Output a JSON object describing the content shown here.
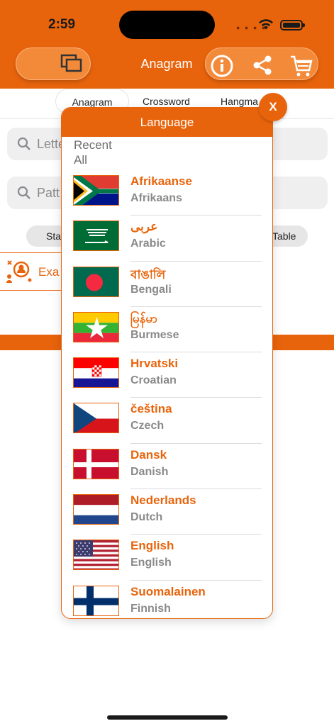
{
  "status_bar": {
    "time": "2:59"
  },
  "header": {
    "title": "Anagram"
  },
  "segmented": {
    "tabs": [
      "Anagram",
      "Crossword",
      "Hangma"
    ]
  },
  "search_letters": {
    "placeholder": "Lette"
  },
  "search_pattern": {
    "placeholder": "Patt"
  },
  "filter_pills": {
    "left": "Sta",
    "right": "Table"
  },
  "example_button": {
    "label": "Exa"
  },
  "modal": {
    "title": "Language",
    "close_label": "X",
    "sections": {
      "recent": "Recent",
      "all": "All"
    },
    "languages": [
      {
        "native": "Afrikaanse",
        "english": "Afrikaans",
        "flag": "south-africa-flag-icon"
      },
      {
        "native": "عربى",
        "english": "Arabic",
        "flag": "saudi-arabia-flag-icon"
      },
      {
        "native": "বাঙালি",
        "english": "Bengali",
        "flag": "bangladesh-flag-icon"
      },
      {
        "native": "မြန်မာ",
        "english": "Burmese",
        "flag": "myanmar-flag-icon"
      },
      {
        "native": "Hrvatski",
        "english": "Croatian",
        "flag": "croatia-flag-icon"
      },
      {
        "native": "čeština",
        "english": "Czech",
        "flag": "czech-flag-icon"
      },
      {
        "native": "Dansk",
        "english": "Danish",
        "flag": "denmark-flag-icon"
      },
      {
        "native": "Nederlands",
        "english": "Dutch",
        "flag": "netherlands-flag-icon"
      },
      {
        "native": "English",
        "english": "English",
        "flag": "usa-flag-icon"
      },
      {
        "native": "Suomalainen",
        "english": "Finnish",
        "flag": "finland-flag-icon"
      }
    ]
  },
  "colors": {
    "accent": "#E8640C",
    "muted_text": "#8a8a8a"
  }
}
